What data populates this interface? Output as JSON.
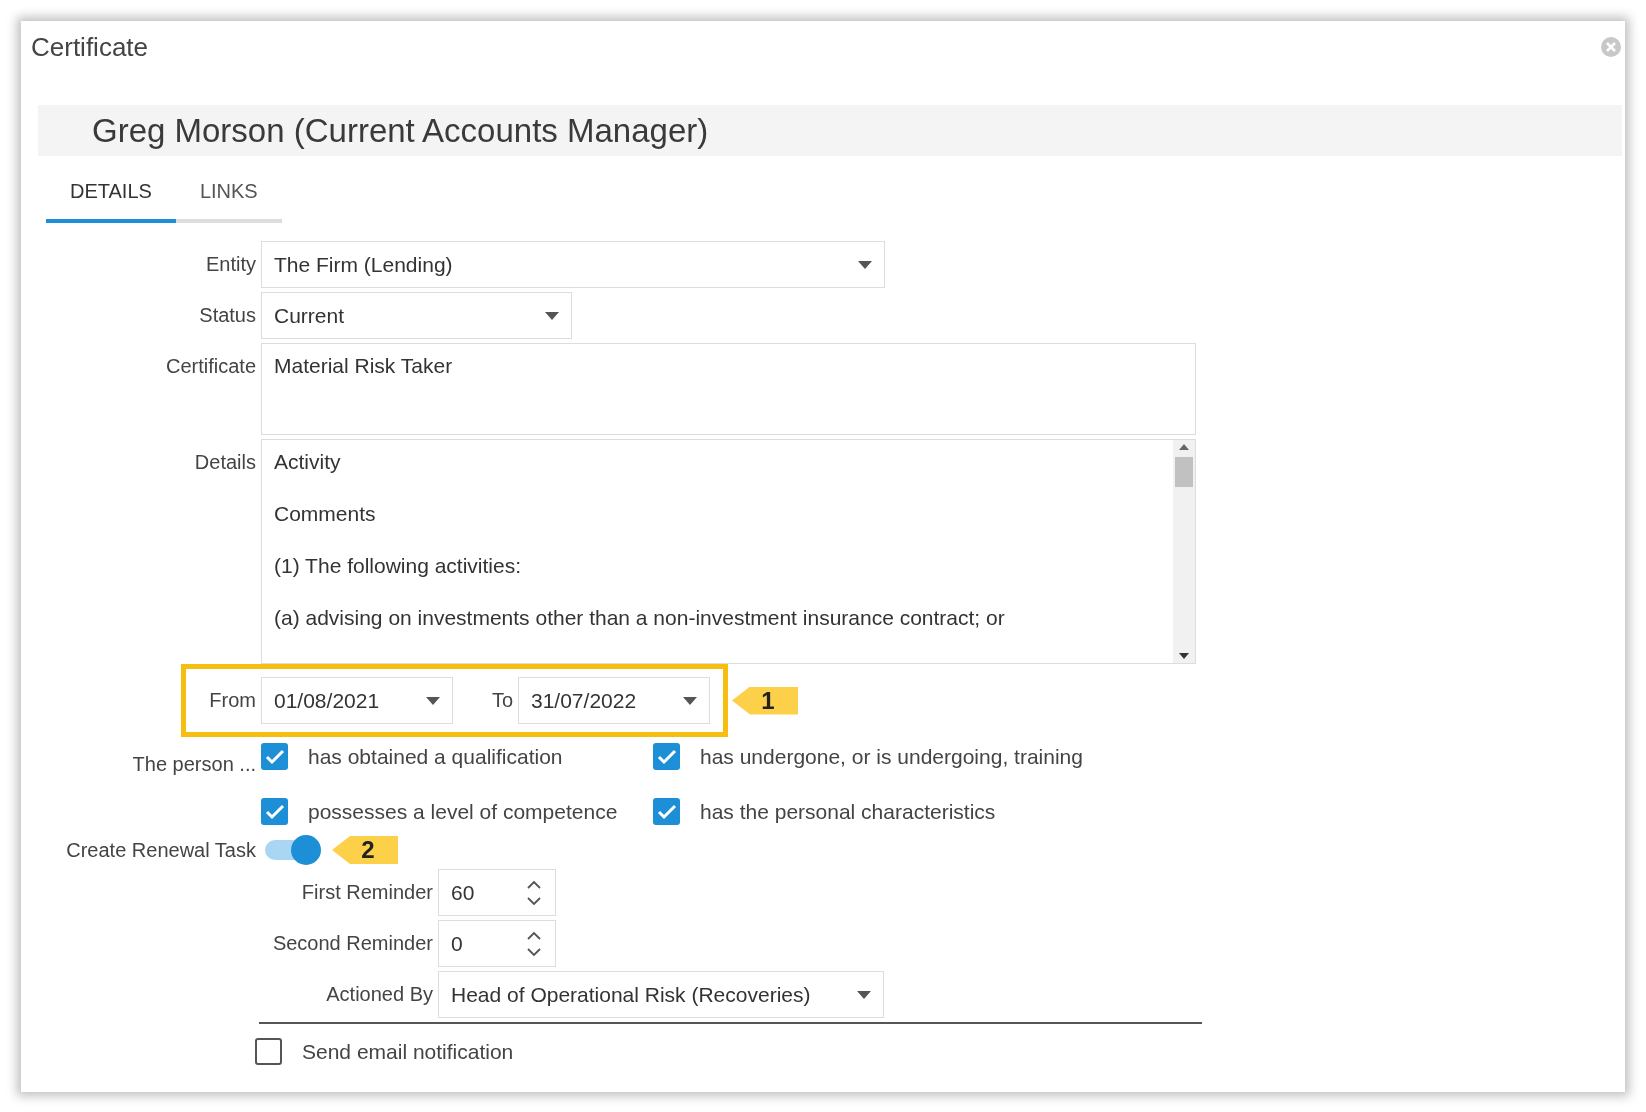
{
  "dialog": {
    "title": "Certificate"
  },
  "header": {
    "name": "Greg Morson (Current Accounts Manager)"
  },
  "tabs": [
    {
      "label": "DETAILS",
      "selected": true
    },
    {
      "label": "LINKS",
      "selected": false
    }
  ],
  "entity": {
    "label": "Entity",
    "value": "The Firm (Lending)"
  },
  "status": {
    "label": "Status",
    "value": "Current"
  },
  "certificate": {
    "label": "Certificate",
    "value": "Material Risk Taker"
  },
  "details": {
    "label": "Details",
    "lines": [
      "Activity",
      "Comments",
      "(1) The following activities:",
      "(a) advising on investments other than a non-investment insurance contract; or"
    ]
  },
  "dates": {
    "from": {
      "label": "From",
      "value": "01/08/2021"
    },
    "to": {
      "label": "To",
      "value": "31/07/2022"
    },
    "callout": "1"
  },
  "person": {
    "label": "The person ...",
    "options": [
      {
        "label": "has obtained a qualification",
        "checked": true
      },
      {
        "label": "has undergone, or is undergoing, training",
        "checked": true
      },
      {
        "label": "possesses a level of competence",
        "checked": true
      },
      {
        "label": "has the personal characteristics",
        "checked": true
      }
    ]
  },
  "renewal": {
    "label": "Create Renewal Task",
    "on": true,
    "callout": "2",
    "first_reminder": {
      "label": "First Reminder",
      "value": "60"
    },
    "second_reminder": {
      "label": "Second Reminder",
      "value": "0"
    },
    "actioned_by": {
      "label": "Actioned By",
      "value": "Head of Operational Risk (Recoveries)"
    }
  },
  "send_email": {
    "label": "Send email notification",
    "checked": false
  }
}
